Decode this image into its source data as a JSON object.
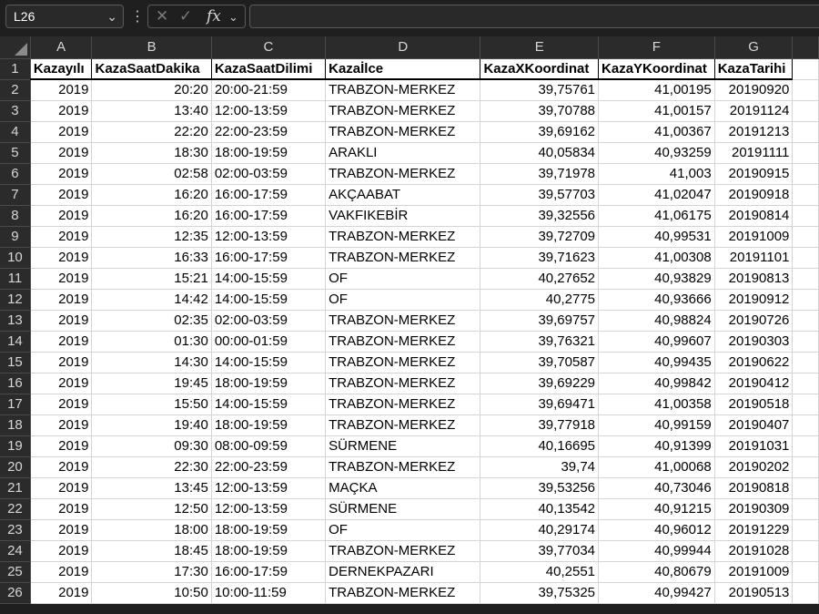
{
  "formula_bar": {
    "name_box": "L26",
    "fx_label": "fx",
    "formula": ""
  },
  "columns": [
    "A",
    "B",
    "C",
    "D",
    "E",
    "F",
    "G"
  ],
  "headers": [
    "Kazayılı",
    "KazaSaatDakika",
    "KazaSaatDilimi",
    "Kazaİlce",
    "KazaXKoordinat",
    "KazaYKoordinat",
    "KazaTarihi"
  ],
  "rows": [
    [
      "2019",
      "20:20",
      "20:00-21:59",
      "TRABZON-MERKEZ",
      "39,75761",
      "41,00195",
      "20190920"
    ],
    [
      "2019",
      "13:40",
      "12:00-13:59",
      "TRABZON-MERKEZ",
      "39,70788",
      "41,00157",
      "20191124"
    ],
    [
      "2019",
      "22:20",
      "22:00-23:59",
      "TRABZON-MERKEZ",
      "39,69162",
      "41,00367",
      "20191213"
    ],
    [
      "2019",
      "18:30",
      "18:00-19:59",
      "ARAKLI",
      "40,05834",
      "40,93259",
      "20191111"
    ],
    [
      "2019",
      "02:58",
      "02:00-03:59",
      "TRABZON-MERKEZ",
      "39,71978",
      "41,003",
      "20190915"
    ],
    [
      "2019",
      "16:20",
      "16:00-17:59",
      "AKÇAABAT",
      "39,57703",
      "41,02047",
      "20190918"
    ],
    [
      "2019",
      "16:20",
      "16:00-17:59",
      "VAKFIKEBİR",
      "39,32556",
      "41,06175",
      "20190814"
    ],
    [
      "2019",
      "12:35",
      "12:00-13:59",
      "TRABZON-MERKEZ",
      "39,72709",
      "40,99531",
      "20191009"
    ],
    [
      "2019",
      "16:33",
      "16:00-17:59",
      "TRABZON-MERKEZ",
      "39,71623",
      "41,00308",
      "20191101"
    ],
    [
      "2019",
      "15:21",
      "14:00-15:59",
      "OF",
      "40,27652",
      "40,93829",
      "20190813"
    ],
    [
      "2019",
      "14:42",
      "14:00-15:59",
      "OF",
      "40,2775",
      "40,93666",
      "20190912"
    ],
    [
      "2019",
      "02:35",
      "02:00-03:59",
      "TRABZON-MERKEZ",
      "39,69757",
      "40,98824",
      "20190726"
    ],
    [
      "2019",
      "01:30",
      "00:00-01:59",
      "TRABZON-MERKEZ",
      "39,76321",
      "40,99607",
      "20190303"
    ],
    [
      "2019",
      "14:30",
      "14:00-15:59",
      "TRABZON-MERKEZ",
      "39,70587",
      "40,99435",
      "20190622"
    ],
    [
      "2019",
      "19:45",
      "18:00-19:59",
      "TRABZON-MERKEZ",
      "39,69229",
      "40,99842",
      "20190412"
    ],
    [
      "2019",
      "15:50",
      "14:00-15:59",
      "TRABZON-MERKEZ",
      "39,69471",
      "41,00358",
      "20190518"
    ],
    [
      "2019",
      "19:40",
      "18:00-19:59",
      "TRABZON-MERKEZ",
      "39,77918",
      "40,99159",
      "20190407"
    ],
    [
      "2019",
      "09:30",
      "08:00-09:59",
      "SÜRMENE",
      "40,16695",
      "40,91399",
      "20191031"
    ],
    [
      "2019",
      "22:30",
      "22:00-23:59",
      "TRABZON-MERKEZ",
      "39,74",
      "41,00068",
      "20190202"
    ],
    [
      "2019",
      "13:45",
      "12:00-13:59",
      "MAÇKA",
      "39,53256",
      "40,73046",
      "20190818"
    ],
    [
      "2019",
      "12:50",
      "12:00-13:59",
      "SÜRMENE",
      "40,13542",
      "40,91215",
      "20190309"
    ],
    [
      "2019",
      "18:00",
      "18:00-19:59",
      "OF",
      "40,29174",
      "40,96012",
      "20191229"
    ],
    [
      "2019",
      "18:45",
      "18:00-19:59",
      "TRABZON-MERKEZ",
      "39,77034",
      "40,99944",
      "20191028"
    ],
    [
      "2019",
      "17:30",
      "16:00-17:59",
      "DERNEKPAZARI",
      "40,2551",
      "40,80679",
      "20191009"
    ],
    [
      "2019",
      "10:50",
      "10:00-11:59",
      "TRABZON-MERKEZ",
      "39,75325",
      "40,99427",
      "20190513"
    ]
  ]
}
